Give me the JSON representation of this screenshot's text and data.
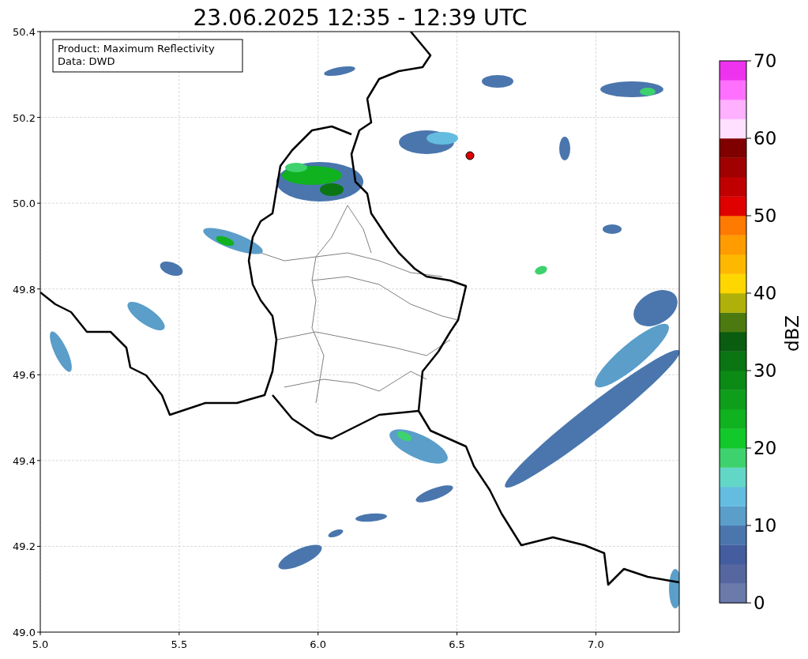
{
  "title": "23.06.2025 12:35 - 12:39 UTC",
  "info_box": {
    "lines": [
      "Product: Maximum Reflectivity",
      "Data: DWD"
    ]
  },
  "x_axis": {
    "ticks": [
      "5.0",
      "5.5",
      "6.0",
      "6.5",
      "7.0"
    ]
  },
  "y_axis": {
    "ticks": [
      "50.4",
      "50.2",
      "50.0",
      "49.8",
      "49.6",
      "49.4",
      "49.2",
      "49.0"
    ]
  },
  "colorbar": {
    "label": "dBZ",
    "ticks": [
      "70",
      "60",
      "50",
      "40",
      "30",
      "20",
      "10",
      "0"
    ],
    "segments": [
      {
        "color": "#6a7aab"
      },
      {
        "color": "#5667a0"
      },
      {
        "color": "#445d9f"
      },
      {
        "color": "#4a76ad"
      },
      {
        "color": "#5a9ec9"
      },
      {
        "color": "#64bde0"
      },
      {
        "color": "#63d7c7"
      },
      {
        "color": "#3ed26e"
      },
      {
        "color": "#12c82a"
      },
      {
        "color": "#10b220"
      },
      {
        "color": "#0f9e1a"
      },
      {
        "color": "#0b8a15"
      },
      {
        "color": "#0a7512"
      },
      {
        "color": "#0a5c10"
      },
      {
        "color": "#4c7a10"
      },
      {
        "color": "#b0b00a"
      },
      {
        "color": "#ffd700"
      },
      {
        "color": "#ffb800"
      },
      {
        "color": "#ff9c00"
      },
      {
        "color": "#ff7a00"
      },
      {
        "color": "#e00000"
      },
      {
        "color": "#c00000"
      },
      {
        "color": "#a00000"
      },
      {
        "color": "#800000"
      },
      {
        "color": "#ffe0ff"
      },
      {
        "color": "#ffb0ff"
      },
      {
        "color": "#ff70ff"
      },
      {
        "color": "#ee33ee"
      }
    ]
  }
}
